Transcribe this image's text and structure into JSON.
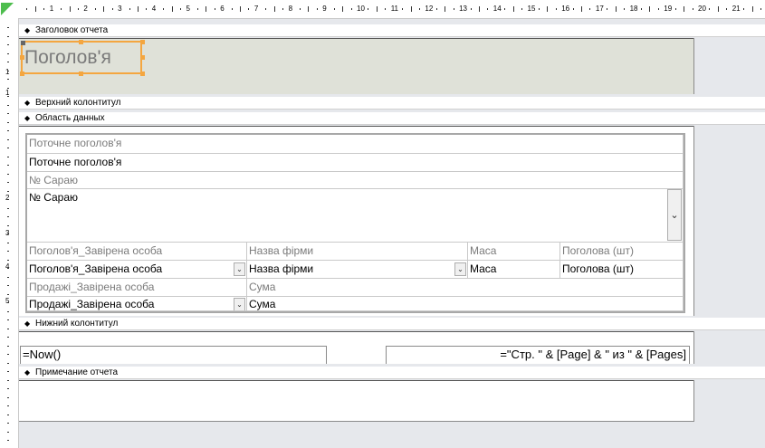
{
  "ruler": {
    "h_numbers": [
      "1",
      "2",
      "3",
      "4",
      "5",
      "6",
      "7",
      "8",
      "9",
      "10",
      "11",
      "12",
      "13",
      "14",
      "15",
      "16",
      "17",
      "18",
      "19",
      "20",
      "21"
    ],
    "v_numbers": [
      "1",
      "1",
      "2",
      "3",
      "4",
      "5"
    ]
  },
  "sections": {
    "report_header": "Заголовок отчета",
    "page_header": "Верхний колонтитул",
    "detail": "Область данных",
    "page_footer": "Нижний колонтитул",
    "report_footer": "Примечание отчета"
  },
  "title": {
    "text": "Поголов'я"
  },
  "fields": {
    "row1": {
      "label": "Поточне поголов'я",
      "control": "Поточне поголов'я"
    },
    "row2": {
      "label": "№ Сараю",
      "control": "№ Сараю"
    },
    "row3": {
      "labels": [
        "Поголов'я_Завірена особа",
        "Назва фірми",
        "Маса",
        "Поголова (шт)"
      ],
      "controls": [
        "Поголов'я_Завірена особа",
        "Назва фірми",
        "Маса",
        "Поголова (шт)"
      ]
    },
    "row4": {
      "labels": [
        "Продажі_Завірена особа",
        "Сума"
      ],
      "controls": [
        "Продажі_Завірена особа",
        "Сума"
      ]
    }
  },
  "footer": {
    "date_expr": "=Now()",
    "page_expr": "=\"Стр. \" & [Page] & \" из \" & [Pages]"
  },
  "icons": {
    "section_marker": "section-marker-icon",
    "dropdown": "chevron-down-icon"
  }
}
